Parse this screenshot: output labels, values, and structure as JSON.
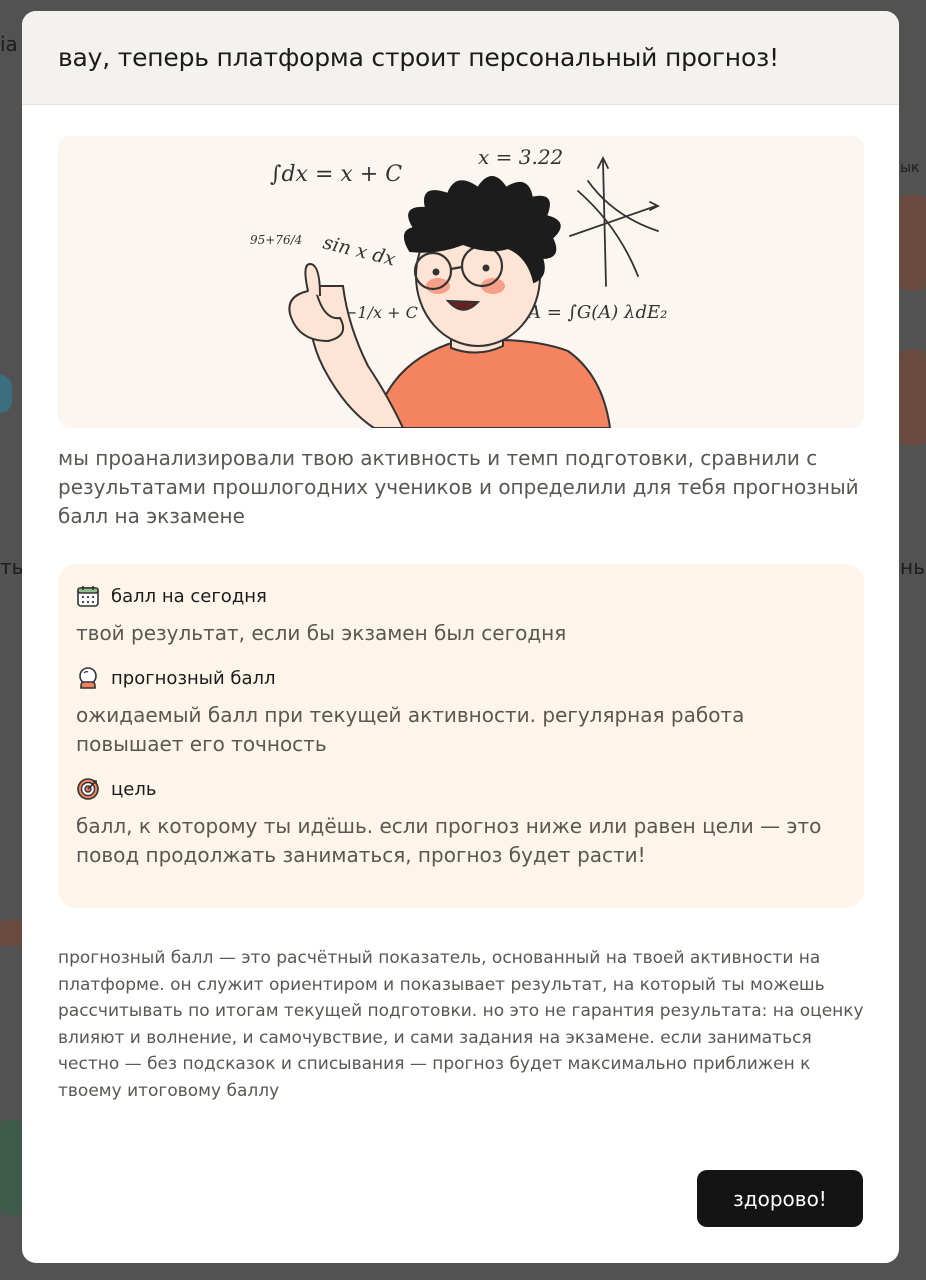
{
  "background": {
    "fragments": [
      "ia",
      "ык",
      "ть",
      "нь"
    ]
  },
  "modal": {
    "title": "вау, теперь платформа строит персональный прогноз!",
    "illustration": {
      "formula_integral": "∫dx = x + C",
      "formula_x": "x = 3.22",
      "formula_fraction": "95+76/4",
      "formula_sin": "sin x dx",
      "formula_minus": "−1/x + C",
      "formula_area": "A = ∫G(A) λdE₂"
    },
    "intro": "мы проанализировали твою активность и темп подготовки, сравнили с результатами прошлогодних учеников и определили для тебя прогнозный балл на экзамене",
    "info_items": [
      {
        "icon": "calendar-icon",
        "title": "балл на сегодня",
        "description": "твой результат, если бы экзамен был сегодня"
      },
      {
        "icon": "crystal-ball-icon",
        "title": "прогнозный балл",
        "description": "ожидаемый балл при текущей активности. регулярная работа повышает его точность"
      },
      {
        "icon": "target-icon",
        "title": "цель",
        "description": "балл, к которому ты идёшь. если прогноз ниже или равен цели — это повод продолжать заниматься, прогноз будет расти!"
      }
    ],
    "disclaimer": "прогнозный балл — это расчётный показатель, основанный на твоей активности на платформе. он служит ориентиром и показывает результат, на который ты можешь рассчитывать по итогам текущей подготовки. но это не гарантия результата: на оценку влияют и волнение, и самочувствие, и сами задания на экзамене. если заниматься честно — без подсказок и списывания — прогноз будет максимально приближен к твоему итоговому баллу",
    "button_label": "здорово!"
  },
  "colors": {
    "overlay": "#525252",
    "header_bg": "#f4f2ee",
    "card_bg": "#fdf5ea",
    "button_bg": "#141414",
    "shirt": "#f4845f"
  }
}
